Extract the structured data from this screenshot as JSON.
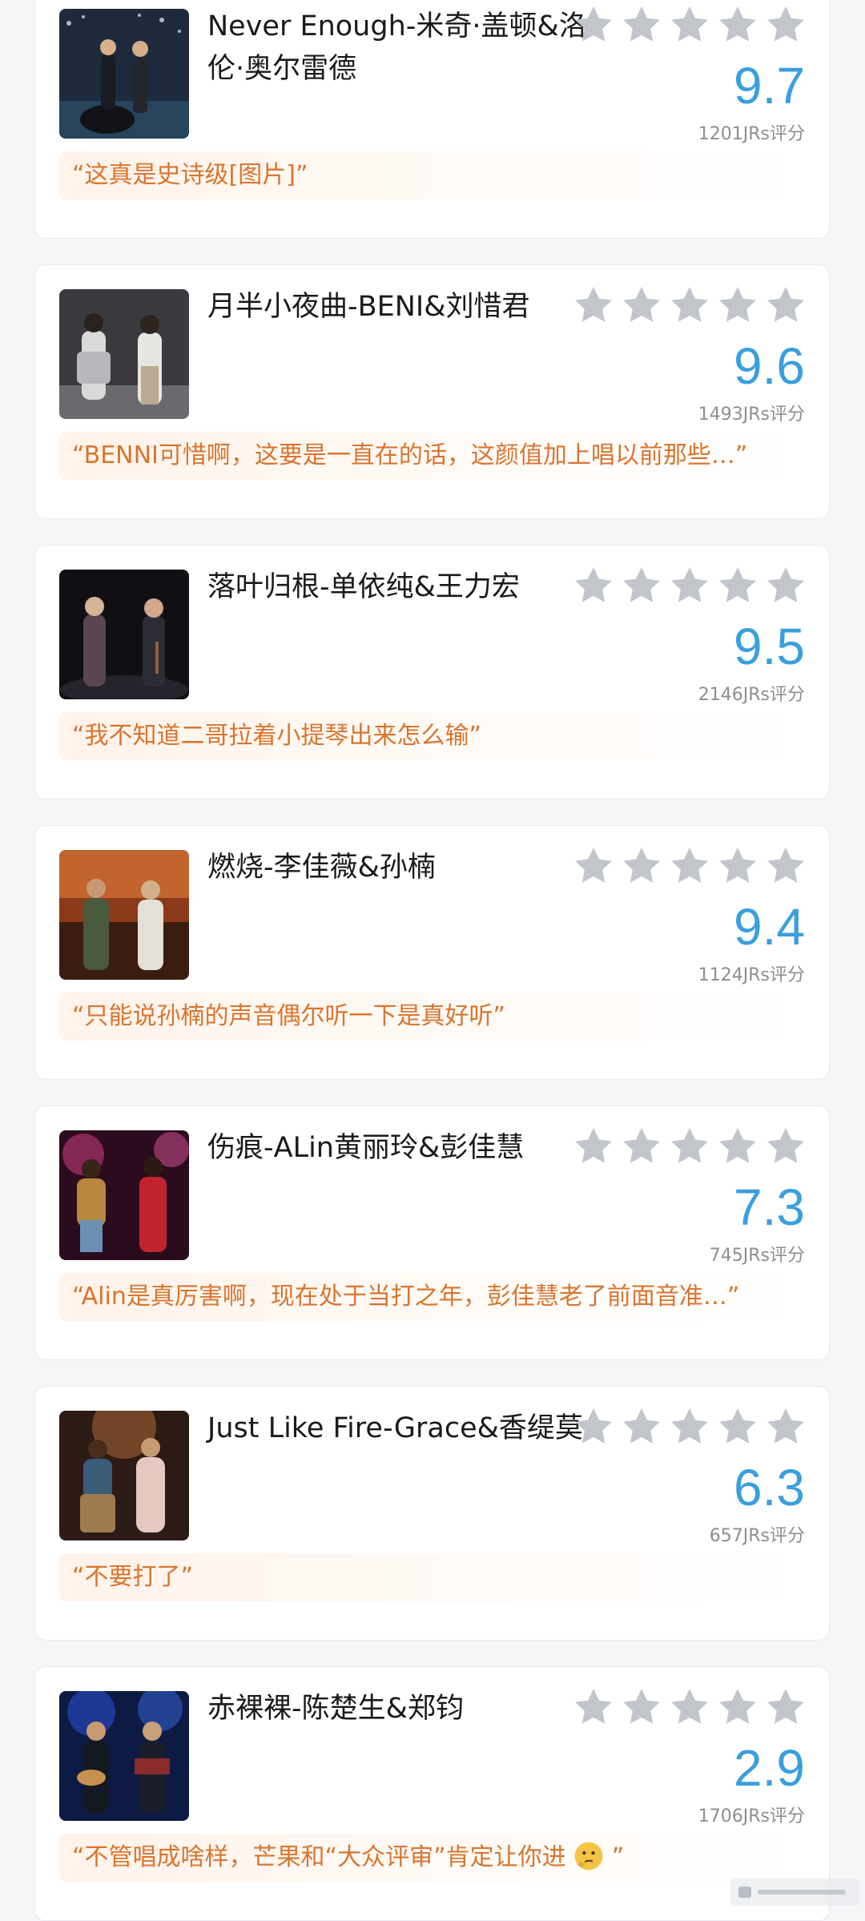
{
  "colors": {
    "background": "#f5f6f8",
    "card": "#ffffff",
    "star": "#c2c5cc",
    "score": "#3a9fde",
    "comment_text": "#d9752e",
    "comment_bg": "#fff3ea"
  },
  "items": [
    {
      "title": "Never Enough-米奇·盖顿&洛伦·奥尔雷德",
      "stars_filled": 0,
      "stars_total": 5,
      "score": "9.7",
      "raters": "1201JRs评分",
      "comment": "“这真是史诗级[图片]”",
      "thumb_icon": "stage-photo-icon"
    },
    {
      "title": "月半小夜曲-BENI&刘惜君",
      "stars_filled": 0,
      "stars_total": 5,
      "score": "9.6",
      "raters": "1493JRs评分",
      "comment": "“BENNI可惜啊，这要是一直在的话，这颜值加上唱以前那些…”",
      "thumb_icon": "stage-photo-icon"
    },
    {
      "title": "落叶归根-单依纯&王力宏",
      "stars_filled": 0,
      "stars_total": 5,
      "score": "9.5",
      "raters": "2146JRs评分",
      "comment": "“我不知道二哥拉着小提琴出来怎么输”",
      "thumb_icon": "stage-photo-icon"
    },
    {
      "title": "燃烧-李佳薇&孙楠",
      "stars_filled": 0,
      "stars_total": 5,
      "score": "9.4",
      "raters": "1124JRs评分",
      "comment": "“只能说孙楠的声音偶尔听一下是真好听”",
      "thumb_icon": "stage-photo-icon"
    },
    {
      "title": "伤痕-ALin黄丽玲&彭佳慧",
      "stars_filled": 0,
      "stars_total": 5,
      "score": "7.3",
      "raters": "745JRs评分",
      "comment": "“Alin是真厉害啊，现在处于当打之年，彭佳慧老了前面音准…”",
      "thumb_icon": "stage-photo-icon"
    },
    {
      "title": "Just Like Fire-Grace&香缇莫",
      "stars_filled": 0,
      "stars_total": 5,
      "score": "6.3",
      "raters": "657JRs评分",
      "comment": "“不要打了”",
      "thumb_icon": "stage-photo-icon"
    },
    {
      "title": "赤裸裸-陈楚生&郑钧",
      "stars_filled": 0,
      "stars_total": 5,
      "score": "2.9",
      "raters": "1706JRs评分",
      "comment": "“不管唱成啥样，芒果和“大众评审”肯定让你进",
      "comment_end": "”",
      "thumb_icon": "stage-photo-icon",
      "comment_emoji": "thinking-face-icon"
    }
  ]
}
